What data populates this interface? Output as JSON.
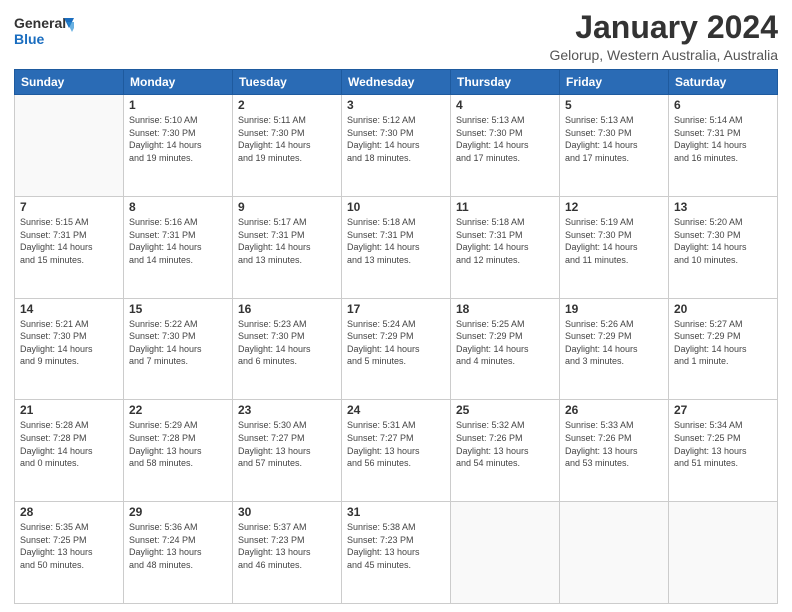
{
  "header": {
    "logo_line1": "General",
    "logo_line2": "Blue",
    "title": "January 2024",
    "subtitle": "Gelorup, Western Australia, Australia"
  },
  "weekdays": [
    "Sunday",
    "Monday",
    "Tuesday",
    "Wednesday",
    "Thursday",
    "Friday",
    "Saturday"
  ],
  "weeks": [
    [
      {
        "day": "",
        "info": ""
      },
      {
        "day": "1",
        "info": "Sunrise: 5:10 AM\nSunset: 7:30 PM\nDaylight: 14 hours\nand 19 minutes."
      },
      {
        "day": "2",
        "info": "Sunrise: 5:11 AM\nSunset: 7:30 PM\nDaylight: 14 hours\nand 19 minutes."
      },
      {
        "day": "3",
        "info": "Sunrise: 5:12 AM\nSunset: 7:30 PM\nDaylight: 14 hours\nand 18 minutes."
      },
      {
        "day": "4",
        "info": "Sunrise: 5:13 AM\nSunset: 7:30 PM\nDaylight: 14 hours\nand 17 minutes."
      },
      {
        "day": "5",
        "info": "Sunrise: 5:13 AM\nSunset: 7:30 PM\nDaylight: 14 hours\nand 17 minutes."
      },
      {
        "day": "6",
        "info": "Sunrise: 5:14 AM\nSunset: 7:31 PM\nDaylight: 14 hours\nand 16 minutes."
      }
    ],
    [
      {
        "day": "7",
        "info": "Sunrise: 5:15 AM\nSunset: 7:31 PM\nDaylight: 14 hours\nand 15 minutes."
      },
      {
        "day": "8",
        "info": "Sunrise: 5:16 AM\nSunset: 7:31 PM\nDaylight: 14 hours\nand 14 minutes."
      },
      {
        "day": "9",
        "info": "Sunrise: 5:17 AM\nSunset: 7:31 PM\nDaylight: 14 hours\nand 13 minutes."
      },
      {
        "day": "10",
        "info": "Sunrise: 5:18 AM\nSunset: 7:31 PM\nDaylight: 14 hours\nand 13 minutes."
      },
      {
        "day": "11",
        "info": "Sunrise: 5:18 AM\nSunset: 7:31 PM\nDaylight: 14 hours\nand 12 minutes."
      },
      {
        "day": "12",
        "info": "Sunrise: 5:19 AM\nSunset: 7:30 PM\nDaylight: 14 hours\nand 11 minutes."
      },
      {
        "day": "13",
        "info": "Sunrise: 5:20 AM\nSunset: 7:30 PM\nDaylight: 14 hours\nand 10 minutes."
      }
    ],
    [
      {
        "day": "14",
        "info": "Sunrise: 5:21 AM\nSunset: 7:30 PM\nDaylight: 14 hours\nand 9 minutes."
      },
      {
        "day": "15",
        "info": "Sunrise: 5:22 AM\nSunset: 7:30 PM\nDaylight: 14 hours\nand 7 minutes."
      },
      {
        "day": "16",
        "info": "Sunrise: 5:23 AM\nSunset: 7:30 PM\nDaylight: 14 hours\nand 6 minutes."
      },
      {
        "day": "17",
        "info": "Sunrise: 5:24 AM\nSunset: 7:29 PM\nDaylight: 14 hours\nand 5 minutes."
      },
      {
        "day": "18",
        "info": "Sunrise: 5:25 AM\nSunset: 7:29 PM\nDaylight: 14 hours\nand 4 minutes."
      },
      {
        "day": "19",
        "info": "Sunrise: 5:26 AM\nSunset: 7:29 PM\nDaylight: 14 hours\nand 3 minutes."
      },
      {
        "day": "20",
        "info": "Sunrise: 5:27 AM\nSunset: 7:29 PM\nDaylight: 14 hours\nand 1 minute."
      }
    ],
    [
      {
        "day": "21",
        "info": "Sunrise: 5:28 AM\nSunset: 7:28 PM\nDaylight: 14 hours\nand 0 minutes."
      },
      {
        "day": "22",
        "info": "Sunrise: 5:29 AM\nSunset: 7:28 PM\nDaylight: 13 hours\nand 58 minutes."
      },
      {
        "day": "23",
        "info": "Sunrise: 5:30 AM\nSunset: 7:27 PM\nDaylight: 13 hours\nand 57 minutes."
      },
      {
        "day": "24",
        "info": "Sunrise: 5:31 AM\nSunset: 7:27 PM\nDaylight: 13 hours\nand 56 minutes."
      },
      {
        "day": "25",
        "info": "Sunrise: 5:32 AM\nSunset: 7:26 PM\nDaylight: 13 hours\nand 54 minutes."
      },
      {
        "day": "26",
        "info": "Sunrise: 5:33 AM\nSunset: 7:26 PM\nDaylight: 13 hours\nand 53 minutes."
      },
      {
        "day": "27",
        "info": "Sunrise: 5:34 AM\nSunset: 7:25 PM\nDaylight: 13 hours\nand 51 minutes."
      }
    ],
    [
      {
        "day": "28",
        "info": "Sunrise: 5:35 AM\nSunset: 7:25 PM\nDaylight: 13 hours\nand 50 minutes."
      },
      {
        "day": "29",
        "info": "Sunrise: 5:36 AM\nSunset: 7:24 PM\nDaylight: 13 hours\nand 48 minutes."
      },
      {
        "day": "30",
        "info": "Sunrise: 5:37 AM\nSunset: 7:23 PM\nDaylight: 13 hours\nand 46 minutes."
      },
      {
        "day": "31",
        "info": "Sunrise: 5:38 AM\nSunset: 7:23 PM\nDaylight: 13 hours\nand 45 minutes."
      },
      {
        "day": "",
        "info": ""
      },
      {
        "day": "",
        "info": ""
      },
      {
        "day": "",
        "info": ""
      }
    ]
  ]
}
